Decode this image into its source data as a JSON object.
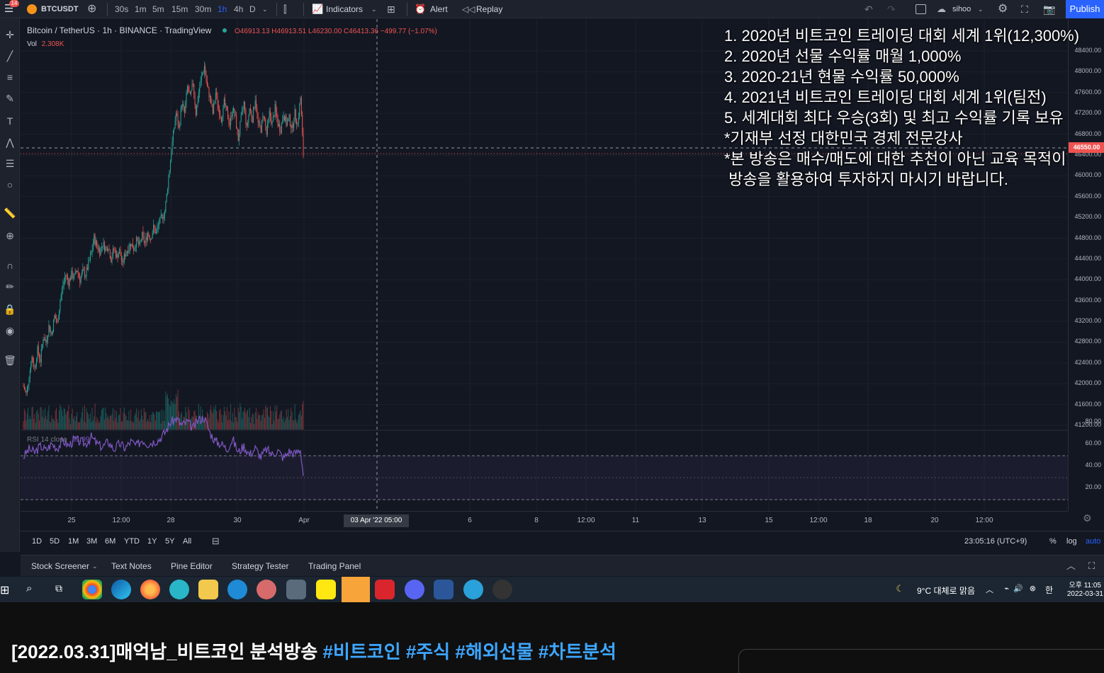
{
  "toolbar": {
    "symbol": "BTCUSDT",
    "notification_count": "14",
    "timeframes": [
      "30s",
      "1m",
      "5m",
      "15m",
      "30m",
      "1h",
      "4h",
      "D"
    ],
    "active_timeframe": "1h",
    "indicators_label": "Indicators",
    "alert_label": "Alert",
    "replay_label": "Replay",
    "layout_name": "sihoo",
    "publish_label": "Publish"
  },
  "legend": {
    "title": "Bitcoin / TetherUS · 1h · BINANCE · TradingView",
    "ohlc": "O46913.13 H46913.51 L46230.00 C46413.36 −499.77 (−1.07%)",
    "vol_label": "Vol",
    "vol_value": "2.308K",
    "rsi_label": "RSI 14 close",
    "rsi_value": "31.99"
  },
  "overlay": {
    "lines": [
      "1. 2020년 비트코인 트레이딩 대회 세계 1위(12,300%)",
      "2. 2020년 선물 수익률 매월 1,000%",
      "3. 2020-21년 현물 수익률 50,000%",
      "4. 2021년 비트코인 트레이딩 대회 세계 1위(팀전)",
      "5. 세계대회 최다 우승(3회) 및 최고 수익률 기록 보유",
      "*기재부 선정 대한민국 경제 전문강사",
      "*본 방송은 매수/매도에 대한 추천이 아닌 교육 목적이",
      " 방송을 활용하여 투자하지 마시기 바랍니다."
    ]
  },
  "price_axis": {
    "ticks": [
      "48400.00",
      "48000.00",
      "47600.00",
      "47200.00",
      "46800.00",
      "46400.00",
      "46000.00",
      "45600.00",
      "45200.00",
      "44800.00",
      "44400.00",
      "44000.00",
      "43600.00",
      "43200.00",
      "42800.00",
      "42400.00",
      "42000.00",
      "41600.00",
      "41200.00"
    ],
    "current_price": "46550.00",
    "rsi_ticks": [
      "80.00",
      "60.00",
      "40.00",
      "20.00"
    ]
  },
  "time_axis": {
    "ticks": [
      "25",
      "12:00",
      "28",
      "30",
      "Apr",
      "6",
      "8",
      "12:00",
      "11",
      "13",
      "15",
      "12:00",
      "18",
      "20",
      "12:00"
    ],
    "crosshair_label": "03 Apr '22   05:00"
  },
  "range_bar": {
    "ranges": [
      "1D",
      "5D",
      "1M",
      "3M",
      "6M",
      "YTD",
      "1Y",
      "5Y",
      "All"
    ],
    "clock": "23:05:16 (UTC+9)",
    "percent_label": "%",
    "log_label": "log",
    "auto_label": "auto"
  },
  "panel_tabs": [
    "Stock Screener",
    "Text Notes",
    "Pine Editor",
    "Strategy Tester",
    "Trading Panel"
  ],
  "taskbar": {
    "weather": "9°C  대체로 맑음",
    "ime": "한",
    "time": "오후 11:05",
    "date": "2022-03-31"
  },
  "video": {
    "title_main": "[2022.03.31]매억남_비트코인 분석방송 ",
    "hashtags": "#비트코인 #주식 #해외선물 #차트분석"
  },
  "colors": {
    "up": "#26a69a",
    "down": "#ef5350",
    "rsi": "#7e57c2",
    "accent": "#2962ff"
  },
  "chart_data": {
    "type": "candlestick",
    "symbol": "Bitcoin / TetherUS",
    "interval": "1h",
    "ylim": [
      41200,
      48400
    ],
    "close_path": [
      [
        0,
        41950
      ],
      [
        3,
        41800
      ],
      [
        6,
        42150
      ],
      [
        9,
        42500
      ],
      [
        12,
        42300
      ],
      [
        15,
        42650
      ],
      [
        18,
        42450
      ],
      [
        21,
        42900
      ],
      [
        24,
        42800
      ],
      [
        27,
        43100
      ],
      [
        30,
        42950
      ],
      [
        33,
        43300
      ],
      [
        36,
        43150
      ],
      [
        39,
        43600
      ],
      [
        42,
        43900
      ],
      [
        45,
        44100
      ],
      [
        48,
        43950
      ],
      [
        51,
        44100
      ],
      [
        54,
        44050
      ],
      [
        57,
        44200
      ],
      [
        60,
        44000
      ],
      [
        63,
        44150
      ],
      [
        66,
        44100
      ],
      [
        69,
        44300
      ],
      [
        72,
        44500
      ],
      [
        75,
        44800
      ],
      [
        78,
        44650
      ],
      [
        81,
        44550
      ],
      [
        84,
        44700
      ],
      [
        87,
        44600
      ],
      [
        90,
        44650
      ],
      [
        93,
        44400
      ],
      [
        96,
        44600
      ],
      [
        99,
        44450
      ],
      [
        102,
        44550
      ],
      [
        105,
        44300
      ],
      [
        108,
        44500
      ],
      [
        111,
        44600
      ],
      [
        114,
        44700
      ],
      [
        117,
        44600
      ],
      [
        120,
        44750
      ],
      [
        123,
        44650
      ],
      [
        126,
        44850
      ],
      [
        129,
        44700
      ],
      [
        132,
        44900
      ],
      [
        135,
        44800
      ],
      [
        138,
        45000
      ],
      [
        141,
        44900
      ],
      [
        144,
        45100
      ],
      [
        147,
        45200
      ],
      [
        150,
        45300
      ],
      [
        153,
        45800
      ],
      [
        156,
        46300
      ],
      [
        159,
        46800
      ],
      [
        162,
        47200
      ],
      [
        165,
        46900
      ],
      [
        168,
        47400
      ],
      [
        171,
        47200
      ],
      [
        174,
        47700
      ],
      [
        177,
        47500
      ],
      [
        180,
        47800
      ],
      [
        183,
        47200
      ],
      [
        186,
        47600
      ],
      [
        189,
        47900
      ],
      [
        192,
        48100
      ],
      [
        195,
        47700
      ],
      [
        198,
        47500
      ],
      [
        201,
        47200
      ],
      [
        204,
        47600
      ],
      [
        207,
        47300
      ],
      [
        210,
        47100
      ],
      [
        213,
        47400
      ],
      [
        216,
        47200
      ],
      [
        219,
        47000
      ],
      [
        222,
        47300
      ],
      [
        225,
        47100
      ],
      [
        228,
        46700
      ],
      [
        231,
        47100
      ],
      [
        234,
        47400
      ],
      [
        237,
        46900
      ],
      [
        240,
        47300
      ],
      [
        243,
        47100
      ],
      [
        246,
        47500
      ],
      [
        249,
        47000
      ],
      [
        252,
        46900
      ],
      [
        255,
        47200
      ],
      [
        258,
        46800
      ],
      [
        261,
        47200
      ],
      [
        264,
        47000
      ],
      [
        267,
        47300
      ],
      [
        270,
        47000
      ],
      [
        273,
        46900
      ],
      [
        276,
        47200
      ],
      [
        279,
        47000
      ],
      [
        282,
        47100
      ],
      [
        285,
        46900
      ],
      [
        288,
        47200
      ],
      [
        291,
        47000
      ],
      [
        294,
        47500
      ],
      [
        297,
        46400
      ]
    ],
    "rsi_path": [
      [
        0,
        48
      ],
      [
        6,
        55
      ],
      [
        12,
        52
      ],
      [
        18,
        58
      ],
      [
        24,
        54
      ],
      [
        30,
        60
      ],
      [
        36,
        56
      ],
      [
        42,
        63
      ],
      [
        48,
        58
      ],
      [
        54,
        64
      ],
      [
        60,
        62
      ],
      [
        66,
        60
      ],
      [
        72,
        66
      ],
      [
        78,
        60
      ],
      [
        84,
        57
      ],
      [
        90,
        62
      ],
      [
        96,
        55
      ],
      [
        102,
        60
      ],
      [
        108,
        56
      ],
      [
        114,
        62
      ],
      [
        120,
        58
      ],
      [
        126,
        64
      ],
      [
        132,
        60
      ],
      [
        138,
        62
      ],
      [
        144,
        64
      ],
      [
        150,
        70
      ],
      [
        156,
        79
      ],
      [
        162,
        83
      ],
      [
        168,
        77
      ],
      [
        174,
        80
      ],
      [
        180,
        74
      ],
      [
        186,
        82
      ],
      [
        192,
        84
      ],
      [
        198,
        70
      ],
      [
        204,
        62
      ],
      [
        210,
        60
      ],
      [
        216,
        55
      ],
      [
        222,
        64
      ],
      [
        228,
        52
      ],
      [
        234,
        58
      ],
      [
        240,
        50
      ],
      [
        246,
        56
      ],
      [
        252,
        48
      ],
      [
        258,
        55
      ],
      [
        264,
        50
      ],
      [
        270,
        54
      ],
      [
        276,
        47
      ],
      [
        282,
        53
      ],
      [
        288,
        51
      ],
      [
        294,
        55
      ],
      [
        297,
        32
      ]
    ],
    "rsi_bands": [
      70,
      50,
      30
    ]
  }
}
